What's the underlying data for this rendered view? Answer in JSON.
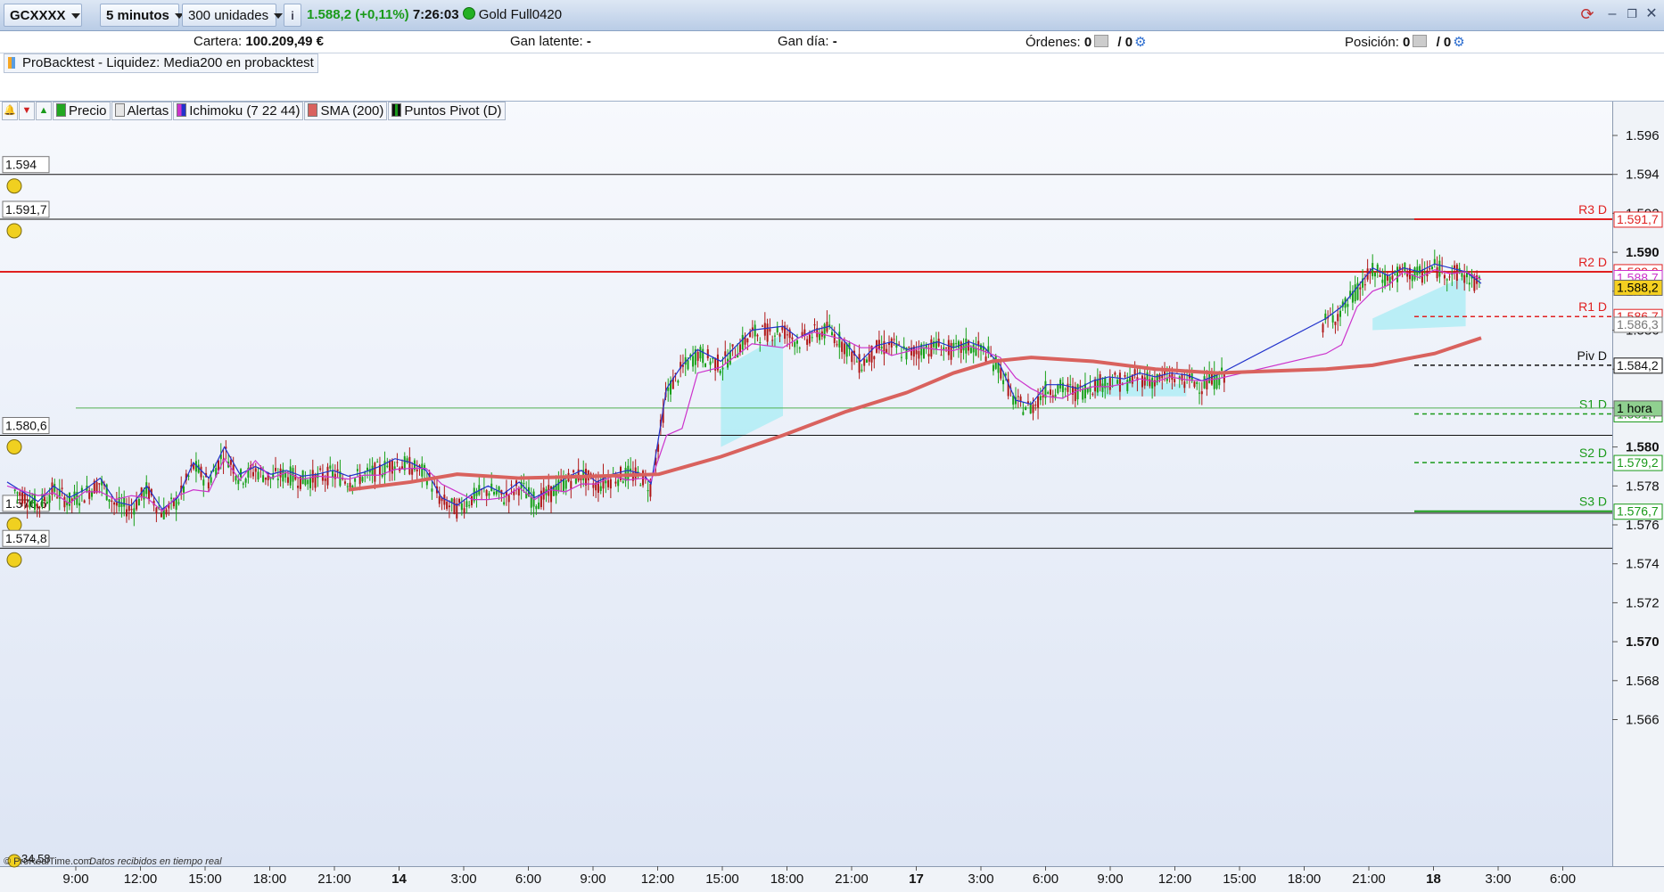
{
  "titlebar": {
    "symbol": "GCXXXX",
    "interval": "5 minutos",
    "units": "300 unidades",
    "info_icon": "info-icon",
    "last_price": "1.588,2 (+0,11%)",
    "time": "7:26:03",
    "instrument": "Gold Full0420",
    "price_color": "#1a9a1a"
  },
  "accountbar": {
    "cartera_label": "Cartera:",
    "cartera_value": "100.209,49 €",
    "gan_latente_label": "Gan latente:",
    "gan_latente_value": "-",
    "gan_dia_label": "Gan día:",
    "gan_dia_value": "-",
    "ordenes_label": "Órdenes:",
    "ordenes_value1": "0",
    "ordenes_value2": "/ 0",
    "posicion_label": "Posición:",
    "posicion_value1": "0",
    "posicion_value2": "/ 0"
  },
  "strategy": {
    "label": "ProBacktest - Liquidez: Media200 en probacktest"
  },
  "legend": {
    "items": [
      {
        "label": "Precio",
        "color": "#22a722"
      },
      {
        "label": "Alertas",
        "color": "#dddddd"
      },
      {
        "label": "Ichimoku (7 22 44)",
        "color": "#cc33cc"
      },
      {
        "label": "SMA (200)",
        "color": "#d9625e"
      },
      {
        "label": "Puntos Pivot (D)",
        "color": "#111111"
      }
    ]
  },
  "alerts": [
    {
      "price": 1.594,
      "label": "1.594"
    },
    {
      "price": 1.5917,
      "label": "1.591,7"
    },
    {
      "price": 1.5806,
      "label": "1.580,6"
    },
    {
      "price": 1.5766,
      "label": "1.576,6"
    },
    {
      "price": 1.5748,
      "label": "1.574,8"
    }
  ],
  "pivots": [
    {
      "name": "R3 D",
      "price": 1.5917,
      "label": "1.591,7",
      "color": "#e02020",
      "style": "solid"
    },
    {
      "name": "R2 D",
      "price": 1.589,
      "label": "1.589,0",
      "color": "#e02020",
      "style": "solid"
    },
    {
      "name": "R1 D",
      "price": 1.5867,
      "label": "1.586,7",
      "color": "#e02020",
      "style": "dashed"
    },
    {
      "name": "Piv D",
      "price": 1.5842,
      "label": "1.584,2",
      "color": "#111111",
      "style": "dashed"
    },
    {
      "name": "S1 D",
      "price": 1.5817,
      "label": "1.581,7",
      "color": "#1a9a1a",
      "style": "dashed"
    },
    {
      "name": "S2 D",
      "price": 1.5792,
      "label": "1.579,2",
      "color": "#1a9a1a",
      "style": "dashed"
    },
    {
      "name": "S3 D",
      "price": 1.5767,
      "label": "1.576,7",
      "color": "#1a9a1a",
      "style": "solid"
    }
  ],
  "tags": [
    {
      "label": "1.588,7",
      "price": 1.5887,
      "color": "#cc33cc"
    },
    {
      "label": "1.588,2",
      "price": 1.5882,
      "color": "#000000",
      "bg": "#f5d020"
    },
    {
      "label": "1.586,3",
      "price": 1.5863,
      "color": "#777777"
    },
    {
      "label": "1 hora",
      "price": 1.582,
      "color": "#000000",
      "bg": "#90d090"
    }
  ],
  "bottom_label": "34,58",
  "footer": {
    "brand": "© ProRealTime.com",
    "note": "Datos recibidos en tiempo real"
  },
  "chart_data": {
    "type": "candlestick",
    "y_ticks": [
      {
        "value": 1.596,
        "label": "1.596"
      },
      {
        "value": 1.594,
        "label": "1.594"
      },
      {
        "value": 1.592,
        "label": "1.592"
      },
      {
        "value": 1.59,
        "label": "1.590",
        "bold": true
      },
      {
        "value": 1.588,
        "label": "1.588"
      },
      {
        "value": 1.586,
        "label": "1.586"
      },
      {
        "value": 1.584,
        "label": "1.584"
      },
      {
        "value": 1.582,
        "label": "1.582"
      },
      {
        "value": 1.58,
        "label": "1.580",
        "bold": true
      },
      {
        "value": 1.578,
        "label": "1.578"
      },
      {
        "value": 1.576,
        "label": "1.576"
      },
      {
        "value": 1.574,
        "label": "1.574"
      },
      {
        "value": 1.572,
        "label": "1.572"
      },
      {
        "value": 1.57,
        "label": "1.570",
        "bold": true
      },
      {
        "value": 1.568,
        "label": "1.568"
      },
      {
        "value": 1.566,
        "label": "1.566"
      }
    ],
    "ylim": [
      1.5648,
      1.5978
    ],
    "x_ticks": [
      {
        "label": "9:00",
        "bold": false
      },
      {
        "label": "12:00",
        "bold": false
      },
      {
        "label": "15:00",
        "bold": false
      },
      {
        "label": "18:00",
        "bold": false
      },
      {
        "label": "21:00",
        "bold": false
      },
      {
        "label": "14",
        "bold": true
      },
      {
        "label": "3:00",
        "bold": false
      },
      {
        "label": "6:00",
        "bold": false
      },
      {
        "label": "9:00",
        "bold": false
      },
      {
        "label": "12:00",
        "bold": false
      },
      {
        "label": "15:00",
        "bold": false
      },
      {
        "label": "18:00",
        "bold": false
      },
      {
        "label": "21:00",
        "bold": false
      },
      {
        "label": "17",
        "bold": true
      },
      {
        "label": "3:00",
        "bold": false
      },
      {
        "label": "6:00",
        "bold": false
      },
      {
        "label": "9:00",
        "bold": false
      },
      {
        "label": "12:00",
        "bold": false
      },
      {
        "label": "15:00",
        "bold": false
      },
      {
        "label": "18:00",
        "bold": false
      },
      {
        "label": "21:00",
        "bold": false
      },
      {
        "label": "18",
        "bold": true
      },
      {
        "label": "3:00",
        "bold": false
      },
      {
        "label": "6:00",
        "bold": false
      }
    ],
    "price_path": [
      [
        0.0,
        1.578
      ],
      [
        0.01,
        1.5775
      ],
      [
        0.02,
        1.577
      ],
      [
        0.03,
        1.5778
      ],
      [
        0.04,
        1.5772
      ],
      [
        0.05,
        1.5776
      ],
      [
        0.06,
        1.5782
      ],
      [
        0.07,
        1.577
      ],
      [
        0.08,
        1.5768
      ],
      [
        0.09,
        1.5778
      ],
      [
        0.1,
        1.5766
      ],
      [
        0.11,
        1.5772
      ],
      [
        0.12,
        1.579
      ],
      [
        0.13,
        1.5782
      ],
      [
        0.14,
        1.5798
      ],
      [
        0.15,
        1.5784
      ],
      [
        0.16,
        1.5788
      ],
      [
        0.17,
        1.5784
      ],
      [
        0.18,
        1.5786
      ],
      [
        0.19,
        1.5783
      ],
      [
        0.2,
        1.5784
      ],
      [
        0.21,
        1.5786
      ],
      [
        0.22,
        1.5783
      ],
      [
        0.23,
        1.5785
      ],
      [
        0.24,
        1.5788
      ],
      [
        0.25,
        1.5792
      ],
      [
        0.26,
        1.579
      ],
      [
        0.27,
        1.5786
      ],
      [
        0.28,
        1.5772
      ],
      [
        0.29,
        1.5768
      ],
      [
        0.3,
        1.5774
      ],
      [
        0.31,
        1.5778
      ],
      [
        0.32,
        1.5774
      ],
      [
        0.33,
        1.578
      ],
      [
        0.34,
        1.5772
      ],
      [
        0.35,
        1.5776
      ],
      [
        0.36,
        1.5782
      ],
      [
        0.37,
        1.5786
      ],
      [
        0.38,
        1.578
      ],
      [
        0.39,
        1.5784
      ],
      [
        0.4,
        1.5786
      ],
      [
        0.41,
        1.5784
      ],
      [
        0.415,
        1.5779
      ],
      [
        0.425,
        1.5828
      ],
      [
        0.435,
        1.584
      ],
      [
        0.445,
        1.5848
      ],
      [
        0.46,
        1.5842
      ],
      [
        0.48,
        1.5858
      ],
      [
        0.5,
        1.586
      ],
      [
        0.51,
        1.5854
      ],
      [
        0.52,
        1.5858
      ],
      [
        0.53,
        1.586
      ],
      [
        0.54,
        1.5852
      ],
      [
        0.55,
        1.5842
      ],
      [
        0.56,
        1.585
      ],
      [
        0.57,
        1.5852
      ],
      [
        0.58,
        1.5848
      ],
      [
        0.59,
        1.585
      ],
      [
        0.6,
        1.5852
      ],
      [
        0.61,
        1.5849
      ],
      [
        0.62,
        1.5852
      ],
      [
        0.63,
        1.5849
      ],
      [
        0.64,
        1.584
      ],
      [
        0.65,
        1.5822
      ],
      [
        0.66,
        1.582
      ],
      [
        0.67,
        1.583
      ],
      [
        0.68,
        1.583
      ],
      [
        0.69,
        1.5828
      ],
      [
        0.7,
        1.5832
      ],
      [
        0.71,
        1.5834
      ],
      [
        0.72,
        1.5833
      ],
      [
        0.73,
        1.5836
      ],
      [
        0.74,
        1.5834
      ],
      [
        0.75,
        1.5836
      ],
      [
        0.76,
        1.5835
      ],
      [
        0.77,
        1.5832
      ],
      [
        0.78,
        1.5835
      ],
      [
        0.85,
        1.5864
      ],
      [
        0.86,
        1.587
      ],
      [
        0.87,
        1.588
      ],
      [
        0.88,
        1.589
      ],
      [
        0.89,
        1.5886
      ],
      [
        0.9,
        1.589
      ],
      [
        0.91,
        1.5888
      ],
      [
        0.92,
        1.5892
      ],
      [
        0.93,
        1.589
      ],
      [
        0.94,
        1.5888
      ],
      [
        0.95,
        1.5882
      ]
    ],
    "sma_path": [
      [
        0.22,
        1.5778
      ],
      [
        0.26,
        1.5782
      ],
      [
        0.29,
        1.5786
      ],
      [
        0.33,
        1.5784
      ],
      [
        0.38,
        1.5785
      ],
      [
        0.42,
        1.5786
      ],
      [
        0.46,
        1.5795
      ],
      [
        0.5,
        1.5806
      ],
      [
        0.54,
        1.5818
      ],
      [
        0.58,
        1.5828
      ],
      [
        0.61,
        1.5838
      ],
      [
        0.635,
        1.5844
      ],
      [
        0.66,
        1.5846
      ],
      [
        0.7,
        1.5844
      ],
      [
        0.74,
        1.584
      ],
      [
        0.78,
        1.5838
      ],
      [
        0.85,
        1.584
      ],
      [
        0.88,
        1.5842
      ],
      [
        0.92,
        1.5848
      ],
      [
        0.95,
        1.5856
      ]
    ],
    "cloud_segments": [
      {
        "x": [
          0.46,
          0.5
        ],
        "top": [
          1.584,
          1.5858
        ],
        "bottom": [
          1.58,
          1.5816
        ]
      },
      {
        "x": [
          0.88,
          0.94
        ],
        "top": [
          1.5866,
          1.5888
        ],
        "bottom": [
          1.586,
          1.5862
        ]
      },
      {
        "x": [
          0.7,
          0.76
        ],
        "top": [
          1.5836,
          1.5832
        ],
        "bottom": [
          1.5826,
          1.5826
        ]
      }
    ]
  }
}
